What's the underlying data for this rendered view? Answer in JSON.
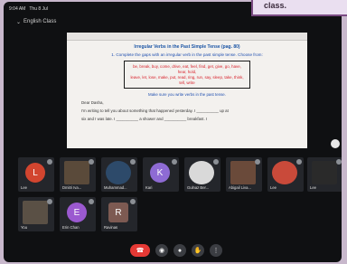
{
  "sticker_text": "class.",
  "status": {
    "time": "9:04 AM",
    "date": "Thu 8 Jul"
  },
  "meeting": {
    "title": "English Class"
  },
  "document": {
    "title": "Irregular Verbs in the Past Simple Tense (pag. 80)",
    "instruction": "1. Complete the gaps with an irregular verb in the past simple tense. Choose from:",
    "verbs_line1": "be, break, buy, come, drive, eat, feel, find, get, give, go, have, hear, hold,",
    "verbs_line2": "leave, let, lose, make, put, read, ring, run, say, sleep, take, think, tell, write",
    "line1": "Make sure you write verbs in the past tense.",
    "line2": "Dear Dasha,",
    "line3": "I'm writing to tell you about something that happened yesterday. I __________ up at",
    "line4": "six and I was late. I __________ a shower and __________ breakfast. I"
  },
  "participants": [
    {
      "name": "Lee",
      "initial": "L",
      "color": "#d2452f",
      "kind": "avatar"
    },
    {
      "name": "Dmitri Iva...",
      "initial": "",
      "color": "#5a4a3a",
      "kind": "photo"
    },
    {
      "name": "Muhammad...",
      "initial": "",
      "color": "#2d4a6a",
      "kind": "photo"
    },
    {
      "name": "Kari",
      "initial": "K",
      "color": "#8e6bd4",
      "kind": "avatar"
    },
    {
      "name": "Gulnaz Ber...",
      "initial": "",
      "color": "#d9d9d9",
      "kind": "photo"
    },
    {
      "name": "Abigail Liva...",
      "initial": "",
      "color": "#6a4a3a",
      "kind": "photo"
    },
    {
      "name": "Lee",
      "initial": "",
      "color": "#c94a3a",
      "kind": "photo"
    },
    {
      "name": "Lee",
      "initial": "",
      "color": "#2a2a2a",
      "kind": "photo"
    },
    {
      "name": "You",
      "initial": "",
      "color": "#5a5045",
      "kind": "photo"
    },
    {
      "name": "Erin Chan",
      "initial": "E",
      "color": "#9b59d0",
      "kind": "avatar"
    },
    {
      "name": "Ravinas",
      "initial": "R",
      "color": "#7d5a52",
      "kind": "avatar"
    }
  ],
  "controls": {
    "end": "☎",
    "camera": "◉",
    "mic": "●",
    "hand": "✋",
    "more": "⋮"
  }
}
